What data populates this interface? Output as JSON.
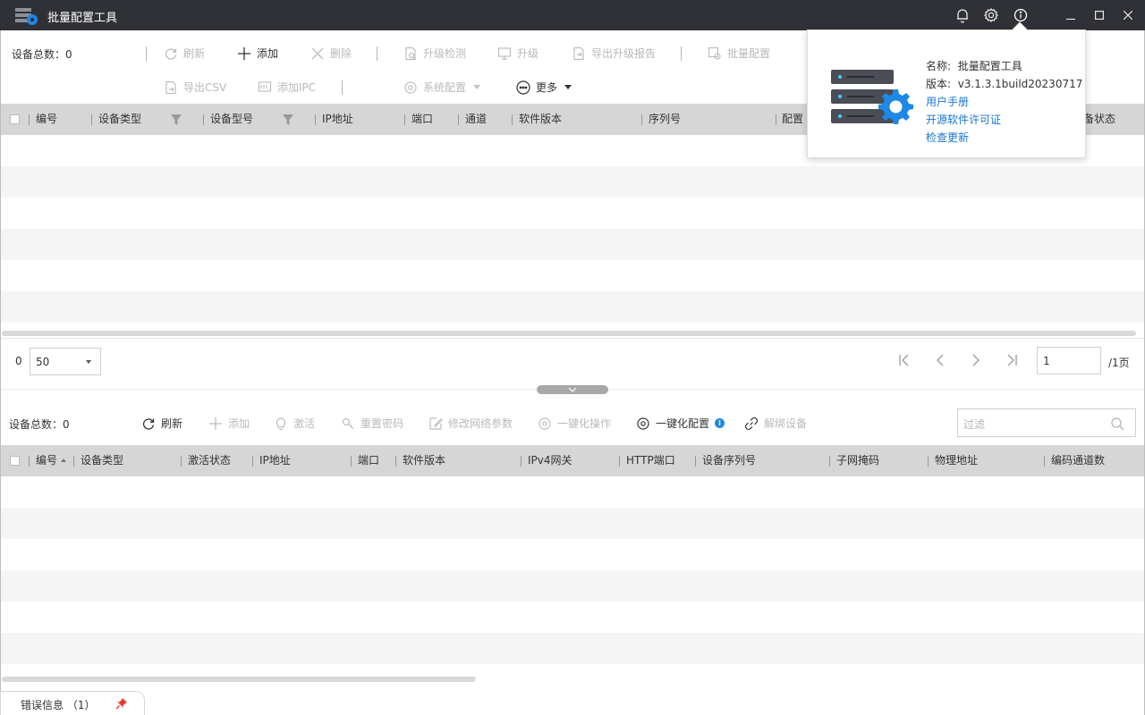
{
  "app": {
    "title": "批量配置工具"
  },
  "top": {
    "device_count": "设备总数：0",
    "toolbar_row1": [
      {
        "label": "刷新",
        "enabled": false,
        "icon": "refresh-icon"
      },
      {
        "label": "添加",
        "enabled": true,
        "icon": "plus-icon"
      },
      {
        "label": "删除",
        "enabled": false,
        "icon": "close-icon"
      },
      {
        "label": "升级检测",
        "enabled": false,
        "icon": "upgrade-check-icon"
      },
      {
        "label": "升级",
        "enabled": false,
        "icon": "upgrade-icon"
      },
      {
        "label": "导出升级报告",
        "enabled": false,
        "icon": "export-report-icon"
      },
      {
        "label": "批量配置",
        "enabled": false,
        "icon": "batch-config-icon"
      }
    ],
    "toolbar_row2": [
      {
        "label": "导出CSV",
        "enabled": false,
        "icon": "export-csv-icon"
      },
      {
        "label": "添加IPC",
        "enabled": false,
        "icon": "add-ipc-icon"
      },
      {
        "label": "系统配置",
        "enabled": false,
        "icon": "gear-icon"
      },
      {
        "label": "更多",
        "enabled": true,
        "icon": "more-icon"
      }
    ],
    "columns": [
      "编号",
      "设备类型",
      "设备型号",
      "IP地址",
      "端口",
      "通道",
      "软件版本",
      "序列号",
      "配置",
      "备状态"
    ]
  },
  "pager": {
    "count": "0",
    "page_size": "50",
    "current_page": "1",
    "total_pages": "/1页"
  },
  "bottom": {
    "device_count": "设备总数：0",
    "toolbar": [
      {
        "label": "刷新",
        "enabled": true,
        "icon": "refresh-icon"
      },
      {
        "label": "添加",
        "enabled": false,
        "icon": "plus-icon"
      },
      {
        "label": "激活",
        "enabled": false,
        "icon": "activate-icon"
      },
      {
        "label": "重置密码",
        "enabled": false,
        "icon": "reset-password-icon"
      },
      {
        "label": "修改网络参数",
        "enabled": false,
        "icon": "edit-network-icon"
      },
      {
        "label": "一键化操作",
        "enabled": false,
        "icon": "gear-icon"
      },
      {
        "label": "一键化配置",
        "enabled": true,
        "icon": "gear-icon"
      },
      {
        "label": "解绑设备",
        "enabled": false,
        "icon": "unlink-icon"
      }
    ],
    "filter_placeholder": "过滤",
    "columns": [
      "编号",
      "设备类型",
      "激活状态",
      "IP地址",
      "端口",
      "软件版本",
      "IPv4网关",
      "HTTP端口",
      "设备序列号",
      "子网掩码",
      "物理地址",
      "编码通道数"
    ]
  },
  "error_tab": {
    "label": "错误信息 （1）"
  },
  "about": {
    "name_label": "名称:",
    "name_value": "批量配置工具",
    "version_label": "版本:",
    "version_value": "v3.1.3.1build20230717",
    "links": [
      "用户手册",
      "开源软件许可证",
      "检查更新"
    ]
  },
  "colors": {
    "titlebar": "#2f3136",
    "header": "#d6d6d6",
    "link": "#1976d2",
    "accent": "#1e88e5"
  }
}
